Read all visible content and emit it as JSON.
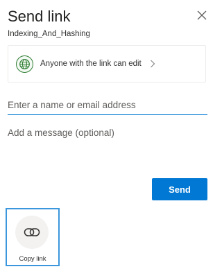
{
  "dialog": {
    "title": "Send link",
    "close_icon": "close-icon",
    "file_name": "Indexing_And_Hashing"
  },
  "permission": {
    "icon": "globe-icon",
    "label": "Anyone with the link can edit",
    "chevron_icon": "chevron-right-icon",
    "icon_color": "#2e7d32"
  },
  "recipients": {
    "placeholder": "Enter a name or email address",
    "value": ""
  },
  "message": {
    "placeholder": "Add a message (optional)",
    "value": ""
  },
  "actions": {
    "send_label": "Send",
    "accent_color": "#0078d4"
  },
  "share_options": [
    {
      "icon": "link-icon",
      "label": "Copy link"
    }
  ]
}
